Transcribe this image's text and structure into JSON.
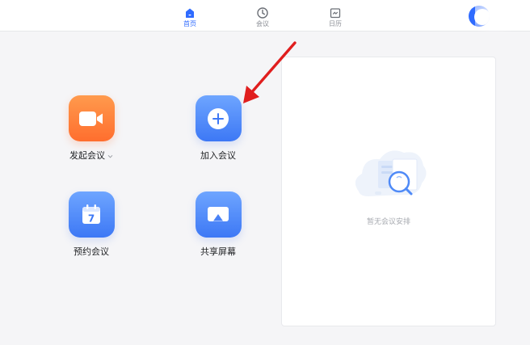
{
  "nav": {
    "tabs": [
      {
        "label": "首页",
        "icon": "home-icon",
        "active": true
      },
      {
        "label": "会议",
        "icon": "clock-icon",
        "active": false
      },
      {
        "label": "日历",
        "icon": "calendar-icon",
        "active": false
      }
    ]
  },
  "actions": {
    "start": {
      "label": "发起会议",
      "icon": "video-camera-icon"
    },
    "join": {
      "label": "加入会议",
      "icon": "plus-icon"
    },
    "schedule": {
      "label": "预约会议",
      "icon": "calendar-7-icon",
      "day": "7"
    },
    "share": {
      "label": "共享屏幕",
      "icon": "screen-share-icon"
    }
  },
  "schedule_panel": {
    "empty_text": "暂无会议安排"
  },
  "colors": {
    "accent": "#2f6bff",
    "orange": "#ff7a35",
    "annotation": "#e01e1e"
  }
}
